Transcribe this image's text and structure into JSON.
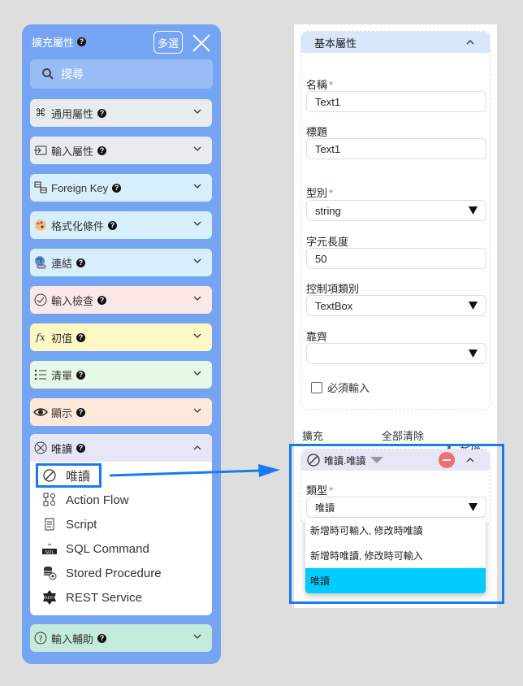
{
  "left_panel": {
    "title": "擴充屬性",
    "multi_select_label": "多選",
    "search_placeholder": "搜尋",
    "colors": {
      "panel": "#75a5f2",
      "search": "#98bdf5"
    },
    "sections": [
      {
        "label": "通用屬性",
        "icon": "command-icon",
        "color": "#e8ecee"
      },
      {
        "label": "輸入屬性",
        "icon": "input-icon",
        "color": "#e8ecee"
      },
      {
        "label": "Foreign Key",
        "icon": "foreign-key-icon",
        "color": "#d6effb"
      },
      {
        "label": "格式化條件",
        "icon": "palette-icon",
        "color": "#d6effb"
      },
      {
        "label": "連結",
        "icon": "link-globe-icon",
        "color": "#d6effb"
      },
      {
        "label": "輸入檢查",
        "icon": "check-circle-icon",
        "color": "#fde8e8"
      },
      {
        "label": "初值",
        "icon": "function-icon",
        "color": "#fdf8c4"
      },
      {
        "label": "清單",
        "icon": "list-icon",
        "color": "#e6f9e6"
      },
      {
        "label": "顯示",
        "icon": "eye-icon",
        "color": "#fde9d9"
      }
    ],
    "readonly_section": {
      "label": "唯讀",
      "icon": "readonly-circle-icon",
      "items": [
        {
          "label": "唯讀",
          "icon": "prohibit-icon",
          "selected": true
        },
        {
          "label": "Action Flow",
          "icon": "action-flow-icon"
        },
        {
          "label": "Script",
          "icon": "script-icon"
        },
        {
          "label": "SQL Command",
          "icon": "sql-icon"
        },
        {
          "label": "Stored Procedure",
          "icon": "stored-procedure-icon"
        },
        {
          "label": "REST Service",
          "icon": "rest-service-icon"
        }
      ]
    },
    "input_assist_section": {
      "label": "輸入輔助",
      "icon": "question-circle-icon",
      "color": "#c4ead9"
    }
  },
  "right_panel": {
    "basic_title": "基本屬性",
    "fields": {
      "name": {
        "label": "名稱",
        "required": "*",
        "value": "Text1"
      },
      "caption": {
        "label": "標題",
        "value": "Text1"
      },
      "type": {
        "label": "型別",
        "required": "*",
        "value": "string"
      },
      "length": {
        "label": "字元長度",
        "value": "50"
      },
      "control_type": {
        "label": "控制項類別",
        "value": "TextBox"
      },
      "align": {
        "label": "靠齊",
        "value": ""
      }
    },
    "required_checkbox": {
      "label": "必須輸入",
      "checked": false
    },
    "extensions": {
      "label": "擴充",
      "clear_all": "全部清除",
      "add": "新增",
      "card": {
        "title": "唯讀.唯讀",
        "type_label": "類型",
        "type_required": "*",
        "type_value": "唯讀",
        "options": [
          {
            "label": "新增時可輸入, 修改時唯讀",
            "active": false
          },
          {
            "label": "新增時唯讀, 修改時可輸入",
            "active": false
          },
          {
            "label": "唯讀",
            "active": true
          }
        ]
      }
    }
  },
  "annotation_color": "#1a7af0"
}
